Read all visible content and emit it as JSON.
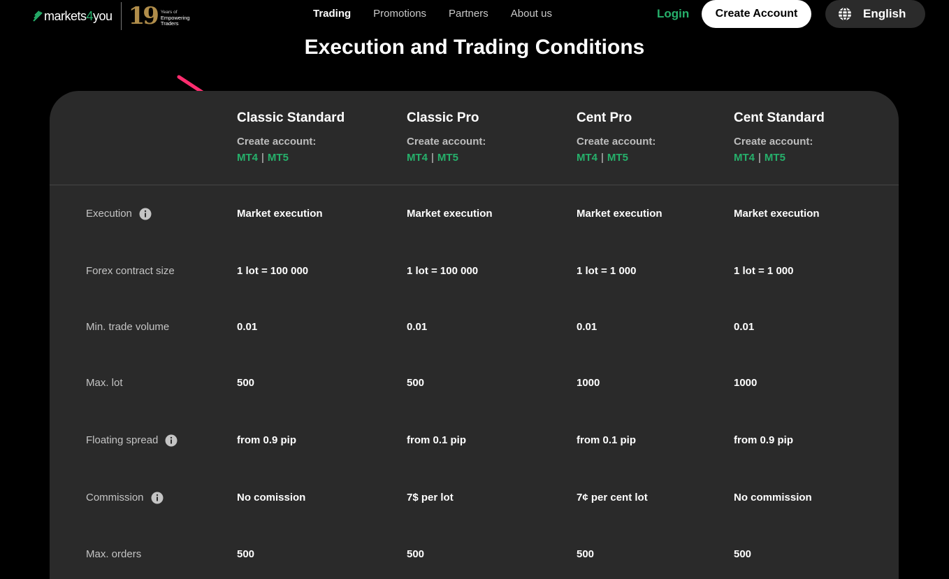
{
  "header": {
    "logo_text_a": "markets",
    "logo_text_b": "4",
    "logo_text_c": "you",
    "badge_number": "19",
    "badge_line1": "Years of",
    "badge_line2": "Empowering",
    "badge_line3": "Traders",
    "nav": [
      {
        "label": "Trading"
      },
      {
        "label": "Promotions"
      },
      {
        "label": "Partners"
      },
      {
        "label": "About us"
      }
    ],
    "login_label": "Login",
    "create_account_label": "Create Account",
    "language_label": "English"
  },
  "section": {
    "title": "Execution and Trading Conditions"
  },
  "colors": {
    "accent_green": "#26b06b",
    "panel_bg": "#2a2a2a",
    "page_bg": "#000000",
    "arrow": "#ff2d6f",
    "badge_gold": "#b08d4a"
  },
  "columns": [
    {
      "title": "Classic Standard",
      "create_label": "Create account:",
      "link_a": "MT4",
      "separator": "|",
      "link_b": "MT5"
    },
    {
      "title": "Classic Pro",
      "create_label": "Create account:",
      "link_a": "MT4",
      "separator": "|",
      "link_b": "MT5"
    },
    {
      "title": "Cent Pro",
      "create_label": "Create account:",
      "link_a": "MT4",
      "separator": "|",
      "link_b": "MT5"
    },
    {
      "title": "Cent Standard",
      "create_label": "Create account:",
      "link_a": "MT4",
      "separator": "|",
      "link_b": "MT5"
    }
  ],
  "rows": [
    {
      "label": "Execution",
      "info": true,
      "values": [
        "Market execution",
        "Market execution",
        "Market execution",
        "Market execution"
      ]
    },
    {
      "label": "Forex contract size",
      "info": false,
      "values": [
        "1 lot = 100 000",
        "1 lot = 100 000",
        "1 lot = 1 000",
        "1 lot = 1 000"
      ]
    },
    {
      "label": "Min. trade volume",
      "info": false,
      "values": [
        "0.01",
        "0.01",
        "0.01",
        "0.01"
      ]
    },
    {
      "label": "Max. lot",
      "info": false,
      "values": [
        "500",
        "500",
        "1000",
        "1000"
      ]
    },
    {
      "label": "Floating spread",
      "info": true,
      "values": [
        "from 0.9 pip",
        "from 0.1 pip",
        "from 0.1 pip",
        "from 0.9 pip"
      ]
    },
    {
      "label": "Commission",
      "info": true,
      "values": [
        "No comission",
        "7$ per lot",
        "7¢ per cent lot",
        "No commission"
      ]
    },
    {
      "label": "Max. orders",
      "info": false,
      "values": [
        "500",
        "500",
        "500",
        "500"
      ]
    }
  ]
}
